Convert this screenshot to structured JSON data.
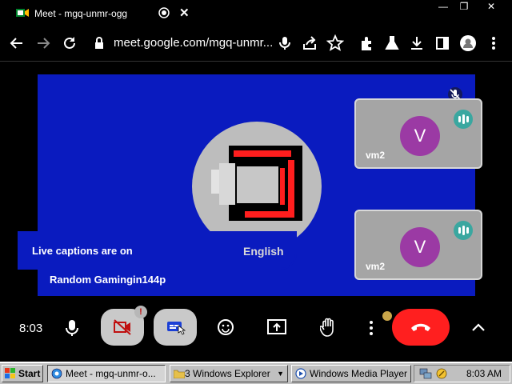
{
  "browser": {
    "tab_title": "Meet - mgq-unmr-ogg",
    "close_glyph": "✕",
    "url": "meet.google.com/mgq-unmr...",
    "window_controls": [
      "—",
      "❐",
      "✕"
    ]
  },
  "stage": {
    "captions_status": "Live captions are on",
    "captions_language": "English",
    "presenter_name": "Random Gamingin144p",
    "tiles": [
      {
        "initial": "V",
        "name": "vm2"
      },
      {
        "initial": "V",
        "name": "vm2"
      }
    ]
  },
  "controls": {
    "time": "8:03",
    "alert_badge": "!",
    "end_call_color": "#ff1f1f"
  },
  "taskbar": {
    "start_label": "Start",
    "items": [
      {
        "label": "Meet - mgq-unmr-o..."
      },
      {
        "label": "3 Windows Explorer"
      },
      {
        "label": "Windows Media Player"
      }
    ],
    "clock": "8:03 AM"
  },
  "colors": {
    "stage_blue": "#0a1bbf",
    "tile_gray": "#a5a5a5",
    "avatar_purple": "#9b3aa4",
    "speaking_teal": "#3aa7a0"
  }
}
